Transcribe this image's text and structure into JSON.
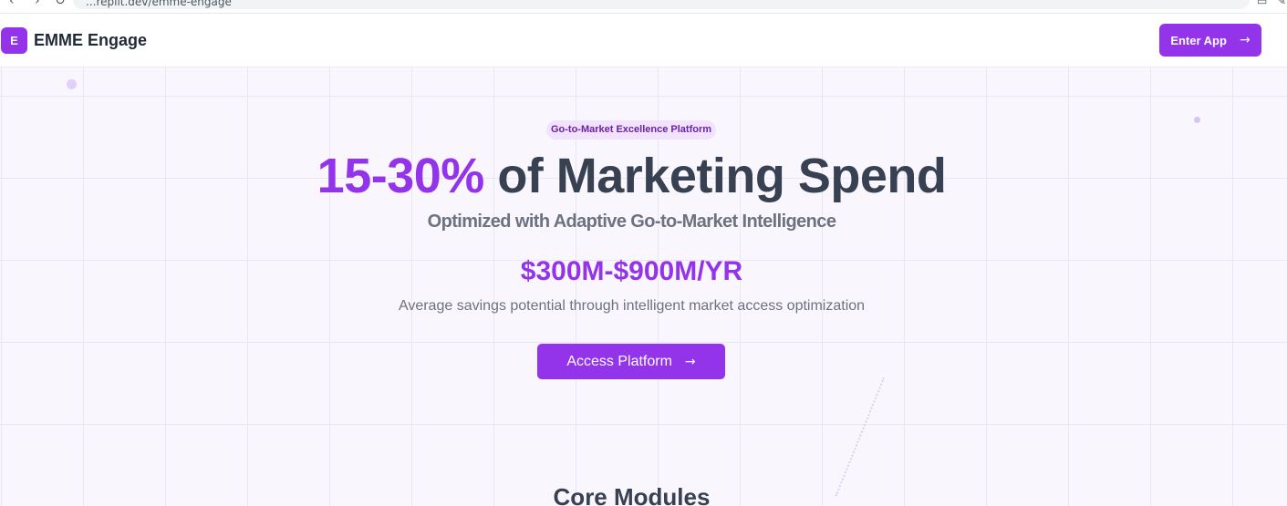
{
  "browser": {
    "url": "...replit.dev/emme-engage",
    "back_glyph": "‹",
    "forward_glyph": "›",
    "reload_glyph": "↻"
  },
  "header": {
    "logo_letter": "E",
    "app_name": "EMME Engage",
    "enter_button_label": "Enter App",
    "arrow": "→"
  },
  "hero": {
    "badge": "Go-to-Market Excellence Platform",
    "headline_accent": "15-30%",
    "headline_rest": "of Marketing Spend",
    "subheadline": "Optimized with Adaptive Go-to-Market Intelligence",
    "savings_range": "$300M-$900M/YR",
    "savings_description": "Average savings potential through intelligent market access optimization",
    "cta_label": "Access Platform",
    "arrow": "→"
  },
  "modules_section": {
    "title": "Core Modules"
  },
  "colors": {
    "accent": "#9333ea",
    "heading": "#374151",
    "muted": "#6b7280",
    "badge_bg": "#f1e2fd"
  }
}
